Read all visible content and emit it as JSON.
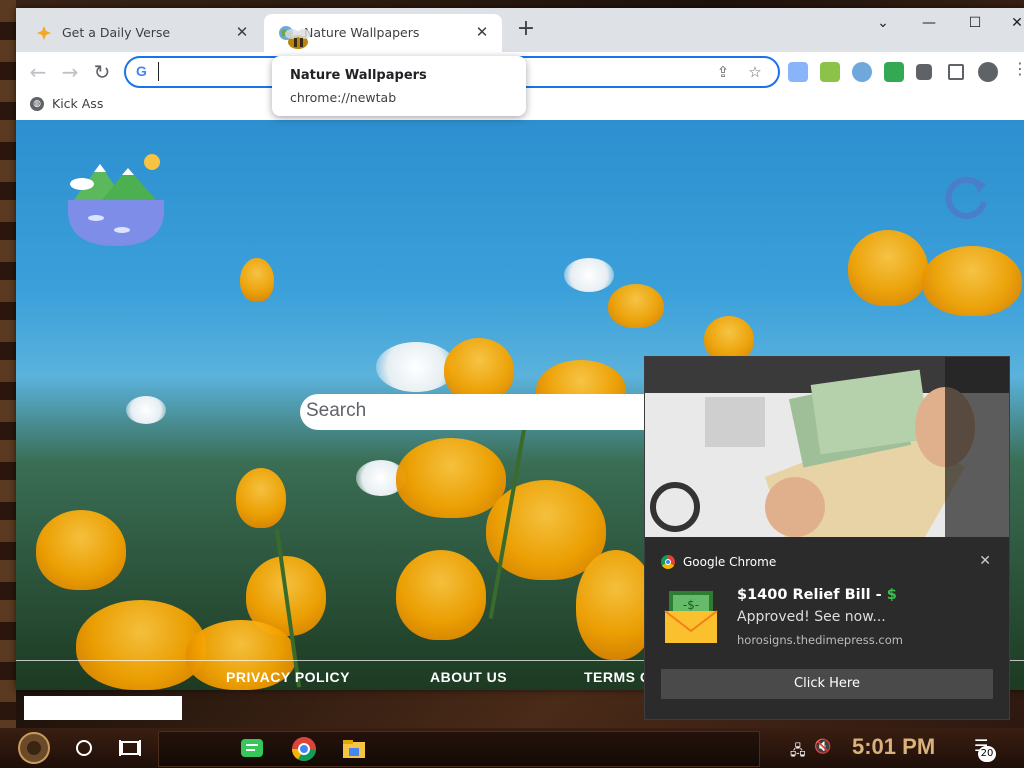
{
  "browser": {
    "tabs": [
      {
        "title": "Get a Daily Verse",
        "icon": "sparkle-icon"
      },
      {
        "title": "Nature Wallpapers",
        "icon": "earth-icon"
      }
    ],
    "hovercard": {
      "title": "Nature Wallpapers",
      "url": "chrome://newtab"
    },
    "omnibox": {
      "value": "",
      "icon": "google-g-icon",
      "g": "G"
    },
    "bookmarks": [
      {
        "label": "Kick Ass",
        "icon": "globe-icon"
      }
    ]
  },
  "page": {
    "search_placeholder": "Search",
    "footer_links": [
      "PRIVACY POLICY",
      "ABOUT US",
      "TERMS O"
    ]
  },
  "notification": {
    "app": "Google Chrome",
    "title": "$1400 Relief Bill -",
    "title_symbol": "$",
    "body": "Approved! See now...",
    "domain": "horosigns.thedimepress.com",
    "action": "Click Here",
    "accent": "#35c24a"
  },
  "taskbar": {
    "clock": "5:01 PM",
    "notification_count": "20"
  }
}
